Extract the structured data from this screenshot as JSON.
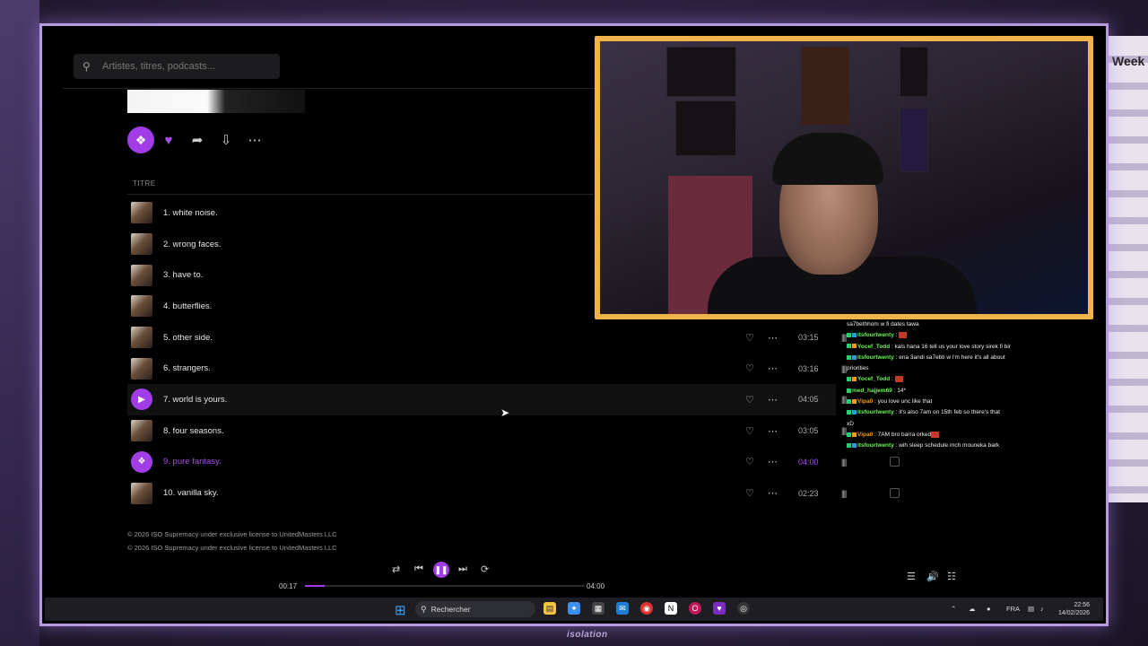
{
  "search": {
    "placeholder": "Artistes, titres, podcasts..."
  },
  "list_header": {
    "title_col": "TITRE"
  },
  "tracks": [
    {
      "title": "1. white noise.",
      "duration": "",
      "state": "normal"
    },
    {
      "title": "2. wrong faces.",
      "duration": "",
      "state": "normal"
    },
    {
      "title": "3. have to.",
      "duration": "",
      "state": "normal"
    },
    {
      "title": "4. butterflies.",
      "duration": "",
      "state": "normal"
    },
    {
      "title": "5. other side.",
      "duration": "03:15",
      "state": "normal"
    },
    {
      "title": "6. strangers.",
      "duration": "03:16",
      "state": "normal"
    },
    {
      "title": "7. world is yours.",
      "duration": "04:05",
      "state": "hover"
    },
    {
      "title": "8. four seasons.",
      "duration": "03:05",
      "state": "normal"
    },
    {
      "title": "9. pure fantasy.",
      "duration": "04:00",
      "state": "playing"
    },
    {
      "title": "10. vanilla sky.",
      "duration": "02:23",
      "state": "normal"
    }
  ],
  "copyright": [
    "© 2026 ISO Supremacy under exclusive license to UnitedMasters LLC",
    "© 2026 ISO Supremacy under exclusive license to UnitedMasters LLC"
  ],
  "player": {
    "elapsed": "00:17",
    "total": "04:00",
    "progress": 0.07
  },
  "chat": [
    {
      "user": "",
      "msg": "sa7bethhom w fi dates tawa"
    },
    {
      "user": "itsfourtwenty",
      "color": "green",
      "msg": " : ",
      "emote": true
    },
    {
      "user": "Yocef_Todd",
      "color": "green",
      "msg": " : kals hana 16 tell us your love story sirek fi bir"
    },
    {
      "user": "itsfourtwenty",
      "color": "green",
      "msg": " : ena 3andi sa7ebti w i'm here it's all about"
    },
    {
      "user": "",
      "msg": "priorities"
    },
    {
      "user": "Yocef_Todd",
      "color": "green",
      "msg": " : ",
      "emote": true
    },
    {
      "user": "med_hajjem69",
      "color": "green",
      "msg": " : 14*"
    },
    {
      "user": "Vipa0",
      "color": "orange",
      "msg": " : you love unc like that"
    },
    {
      "user": "itsfourtwenty",
      "color": "green",
      "msg": " : it's also 7am on 15th feb so there's that"
    },
    {
      "user": "",
      "msg": "xD"
    },
    {
      "user": "Vipa0",
      "color": "orange",
      "msg": " : 7AM bro barra orked",
      "emote": true
    },
    {
      "user": "itsfourtwenty",
      "color": "green",
      "msg": " : wih sleep schedule mch mouneka bark"
    }
  ],
  "taskbar": {
    "search_label": "Rechercher",
    "lang": "FRA",
    "time": "22:56",
    "date": "14/02/2026"
  },
  "watermark": "isolation",
  "colors": {
    "accent": "#a13de6",
    "webcam_border": "#f0b34a",
    "frame": "#b79be0"
  }
}
